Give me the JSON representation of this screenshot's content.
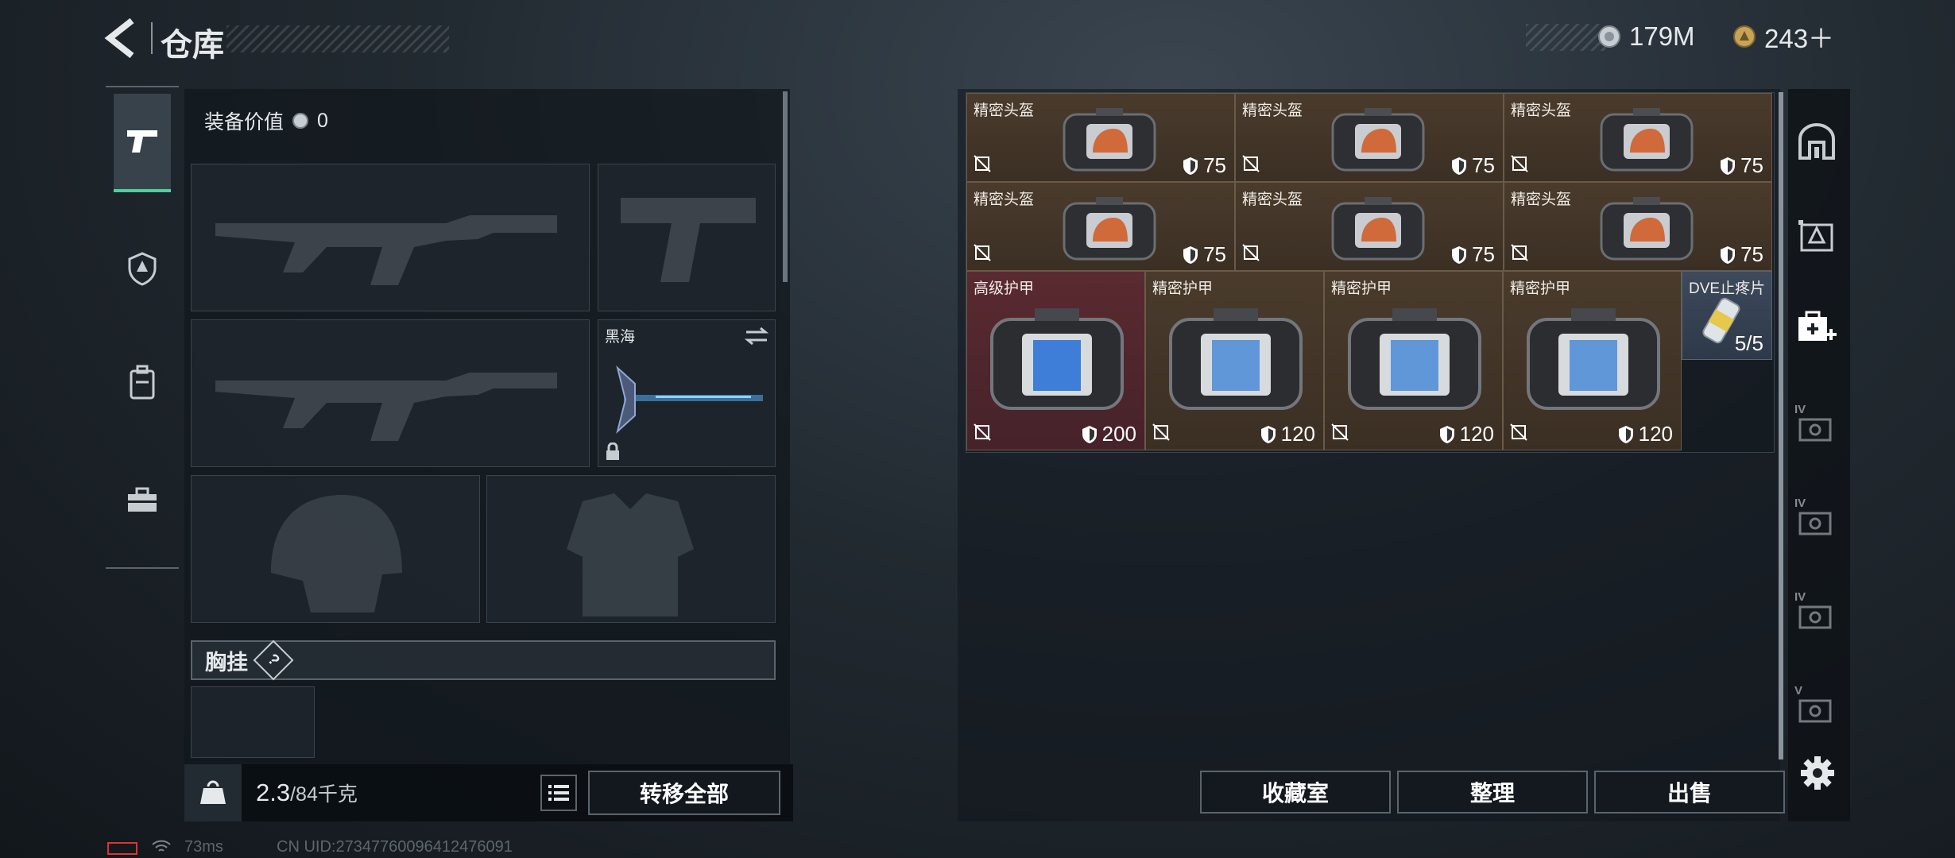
{
  "header": {
    "title": "仓库",
    "currency_silver": "179M",
    "currency_gold": "243＋"
  },
  "loadout": {
    "equip_value_label": "装备价值",
    "equip_value": "0",
    "melee_name": "黑海",
    "chest_rig_label": "胸挂",
    "help_glyph": "?",
    "weight_current": "2.3",
    "weight_max": "/84千克",
    "transfer_all": "转移全部"
  },
  "stash": {
    "items": [
      {
        "name": "精密头盔",
        "value": "75",
        "type": "helmet"
      },
      {
        "name": "精密头盔",
        "value": "75",
        "type": "helmet"
      },
      {
        "name": "精密头盔",
        "value": "75",
        "type": "helmet"
      },
      {
        "name": "精密头盔",
        "value": "75",
        "type": "helmet"
      },
      {
        "name": "精密头盔",
        "value": "75",
        "type": "helmet"
      },
      {
        "name": "精密头盔",
        "value": "75",
        "type": "helmet"
      },
      {
        "name": "高级护甲",
        "value": "200",
        "type": "armor"
      },
      {
        "name": "精密护甲",
        "value": "120",
        "type": "armor"
      },
      {
        "name": "精密护甲",
        "value": "120",
        "type": "armor"
      },
      {
        "name": "精密护甲",
        "value": "120",
        "type": "armor"
      },
      {
        "name": "DVE止疼片",
        "value": "5/5",
        "type": "med"
      }
    ],
    "buttons": {
      "collection": "收藏室",
      "sort": "整理",
      "sell": "出售"
    }
  },
  "right_tabs": [
    "IV",
    "IV",
    "IV",
    "V"
  ],
  "status_bar": {
    "ping": "73ms",
    "uid": "CN UID:27347760096412476091"
  }
}
